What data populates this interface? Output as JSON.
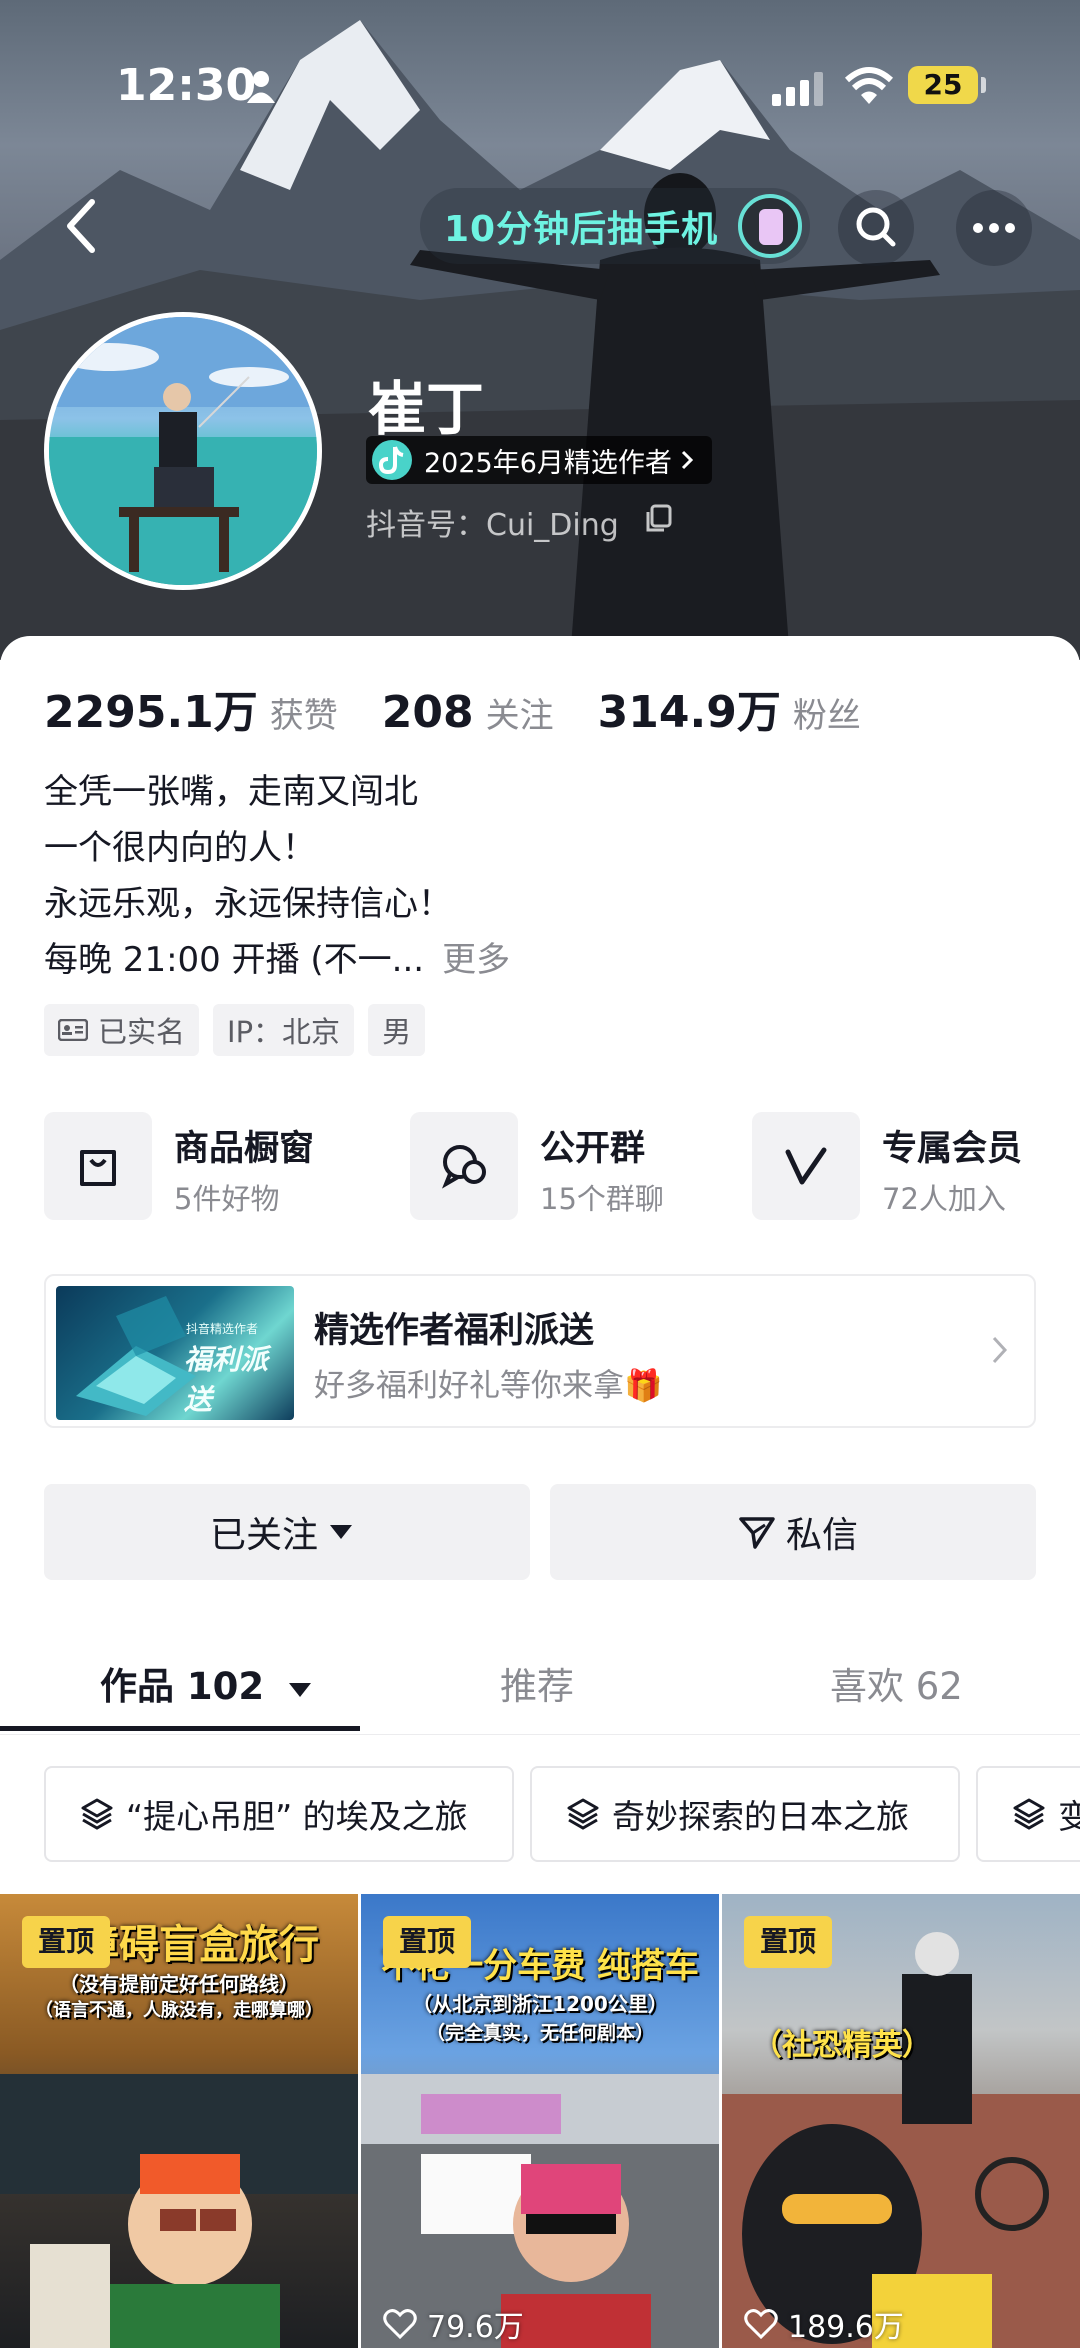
{
  "status_bar": {
    "time": "12:30",
    "battery": "25"
  },
  "nav": {
    "promo": "10分钟后抽手机"
  },
  "profile": {
    "name": "崔丁",
    "author_badge": "2025年6月精选作者",
    "douyin_id": "抖音号：Cui_Ding"
  },
  "stats": [
    {
      "value": "2295.1万",
      "label": "获赞"
    },
    {
      "value": "208",
      "label": "关注"
    },
    {
      "value": "314.9万",
      "label": "粉丝"
    }
  ],
  "bio": {
    "lines": [
      "全凭一张嘴，走南又闯北",
      "一个很内向的人！",
      "永远乐观，永远保持信心！",
      "每晚 21:00 开播 (不一..."
    ],
    "more": "更多"
  },
  "tags": [
    "已实名",
    "IP：北京",
    "男"
  ],
  "services": [
    {
      "title": "商品橱窗",
      "subtitle": "5件好物",
      "icon": "bag-icon"
    },
    {
      "title": "公开群",
      "subtitle": "15个群聊",
      "icon": "chat-icon"
    },
    {
      "title": "专属会员",
      "subtitle": "72人加入",
      "icon": "v-icon"
    }
  ],
  "banner": {
    "image_small_text": "抖音精选作者",
    "image_text": "福利派送",
    "title": "精选作者福利派送",
    "subtitle": "好多福利好礼等你来拿🎁"
  },
  "buttons": {
    "follow": "已关注",
    "message": "私信"
  },
  "tabs": [
    {
      "label": "作品 102",
      "active": true
    },
    {
      "label": "推荐",
      "active": false
    },
    {
      "label": "喜欢 62",
      "active": false
    }
  ],
  "collections": [
    "“提心吊胆” 的埃及之旅",
    "奇妙探索的日本之旅",
    "变"
  ],
  "videos": [
    {
      "pin": "置顶",
      "title": "零障碍盲盒旅行",
      "subtitle1": "（没有提前定好任何路线）",
      "subtitle2": "（语言不通，人脉没有，走哪算哪）",
      "likes": ""
    },
    {
      "pin": "置顶",
      "title": "不花一分车费 纯搭车",
      "subtitle1": "（从北京到浙江1200公里）",
      "subtitle2": "（完全真实，无任何剧本）",
      "likes": "79.6万"
    },
    {
      "pin": "置顶",
      "title": "（社恐精英）",
      "subtitle1": "",
      "subtitle2": "",
      "likes": "189.6万"
    }
  ],
  "colors": {
    "accent_teal": "#6ef3e2",
    "pin_yellow": "#f7d34a",
    "text_primary": "#161823",
    "text_secondary": "#8a8b91"
  }
}
